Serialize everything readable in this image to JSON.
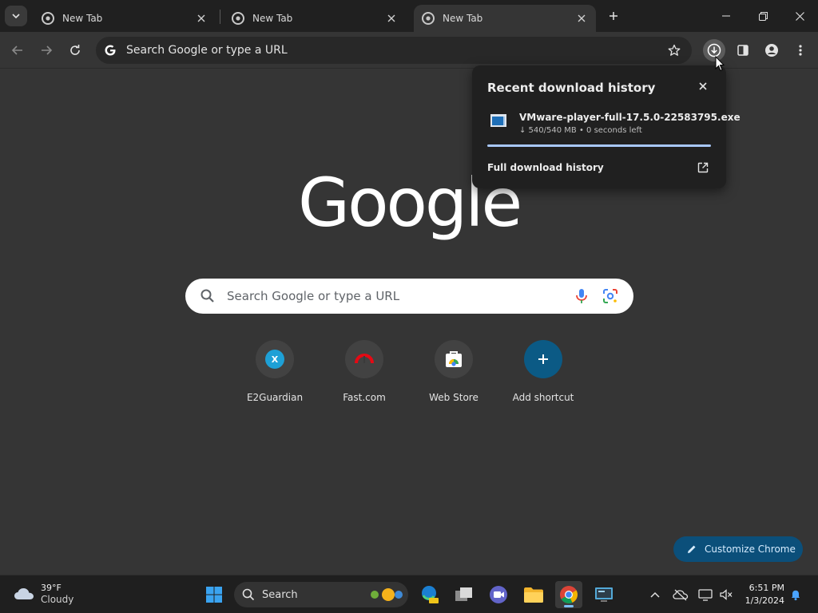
{
  "tabs": [
    {
      "title": "New Tab",
      "active": false
    },
    {
      "title": "New Tab",
      "active": false
    },
    {
      "title": "New Tab",
      "active": true
    }
  ],
  "toolbar": {
    "omnibox_text": "Search Google or type a URL"
  },
  "download_bubble": {
    "title": "Recent download history",
    "filename": "VMware-player-full-17.5.0-22583795.exe",
    "status": "↓ 540/540 MB • 0 seconds left",
    "progress_percent": 100,
    "full_history_label": "Full download history"
  },
  "logo": "Google",
  "search": {
    "placeholder": "Search Google or type a URL"
  },
  "shortcuts": [
    {
      "label": "E2Guardian",
      "badge": "X"
    },
    {
      "label": "Fast.com"
    },
    {
      "label": "Web Store"
    },
    {
      "label": "Add shortcut"
    }
  ],
  "customize_label": "Customize Chrome",
  "taskbar": {
    "weather_temp": "39°F",
    "weather_cond": "Cloudy",
    "search_label": "Search",
    "time": "6:51 PM",
    "date": "1/3/2024"
  },
  "colors": {
    "background": "#353535",
    "accent": "#a8c7fa",
    "customize_bg": "#0b4f7a"
  }
}
